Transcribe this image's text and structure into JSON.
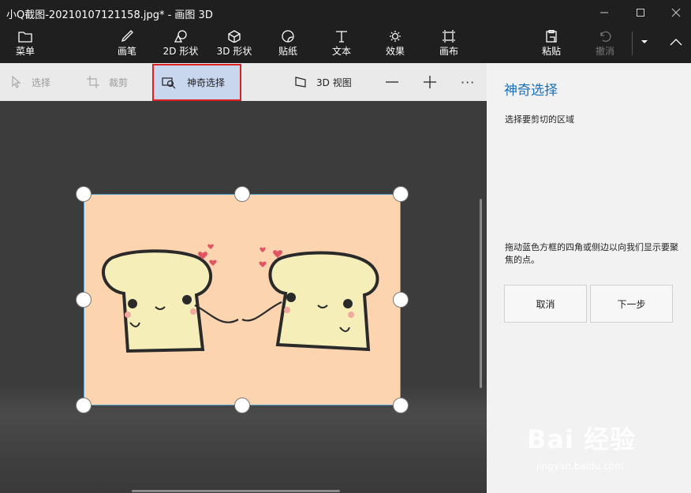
{
  "window": {
    "title": "小Q截图-20210107121158.jpg* - 画图 3D"
  },
  "ribbon": {
    "menu": "菜单",
    "brushes": "画笔",
    "shapes_2d": "2D 形状",
    "shapes_3d": "3D 形状",
    "stickers": "贴纸",
    "text": "文本",
    "effects": "效果",
    "canvas": "画布",
    "paste": "粘贴",
    "undo": "撤消"
  },
  "subbar": {
    "select": "选择",
    "crop": "裁剪",
    "magic_select": "神奇选择",
    "view_3d": "3D 视图",
    "more": "···"
  },
  "panel": {
    "title": "神奇选择",
    "hint_top": "选择要剪切的区域",
    "hint_bottom": "拖动蓝色方框的四角或侧边以向我们显示要聚焦的点。",
    "cancel": "取消",
    "next": "下一步"
  },
  "watermark": {
    "brand": "Bai 经验",
    "url": "jingyan.baidu.com"
  },
  "colors": {
    "title_accent": "#1a6fb5",
    "highlight_border": "#e02020",
    "image_bg": "#fdd4b0",
    "selection_border": "#5aa8d8"
  }
}
